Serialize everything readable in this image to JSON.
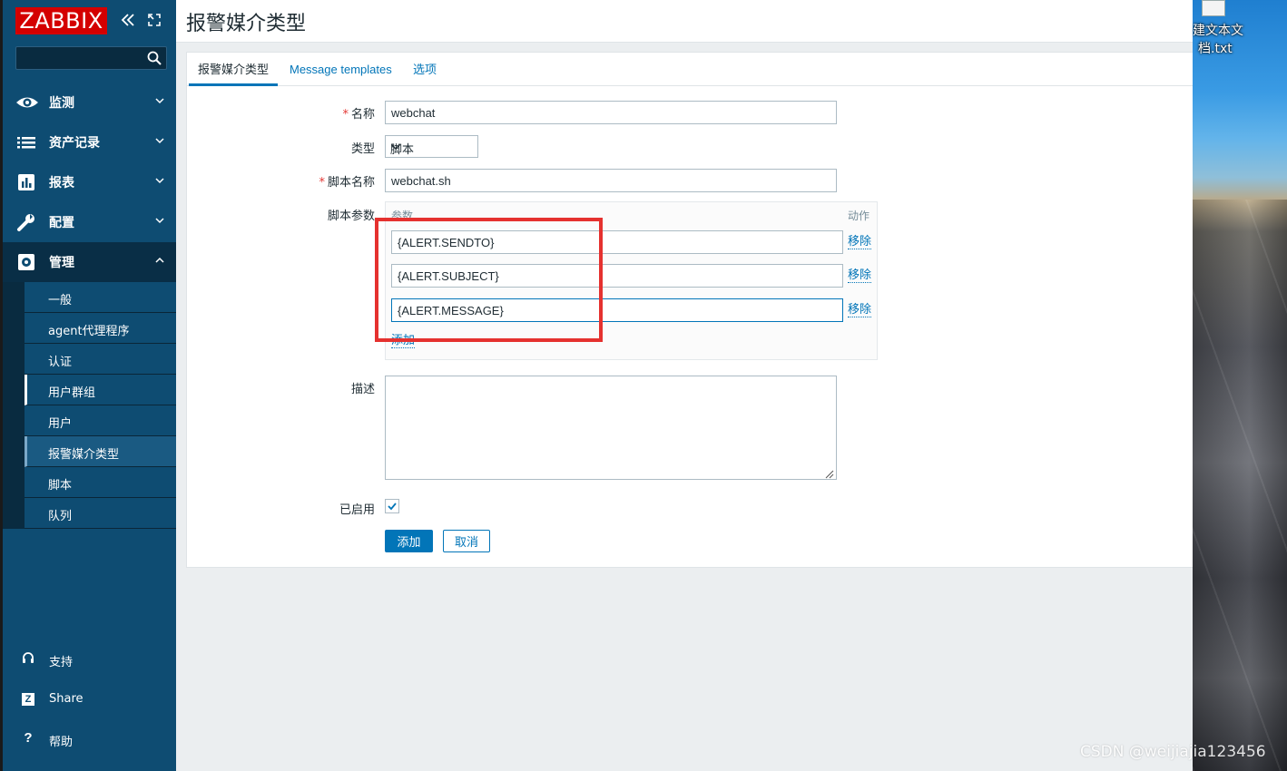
{
  "app": {
    "logo": "ZABBIX"
  },
  "sidebar": {
    "search_placeholder": "",
    "menu": [
      {
        "label": "监测"
      },
      {
        "label": "资产记录"
      },
      {
        "label": "报表"
      },
      {
        "label": "配置"
      },
      {
        "label": "管理"
      }
    ],
    "admin_submenu": [
      {
        "label": "一般"
      },
      {
        "label": "agent代理程序"
      },
      {
        "label": "认证"
      },
      {
        "label": "用户群组"
      },
      {
        "label": "用户"
      },
      {
        "label": "报警媒介类型"
      },
      {
        "label": "脚本"
      },
      {
        "label": "队列"
      }
    ],
    "bottom": [
      {
        "icon": "headset-icon",
        "label": "支持"
      },
      {
        "icon": "zabbix-share-icon",
        "glyph": "Z",
        "label": "Share"
      },
      {
        "icon": "help-icon",
        "glyph": "?",
        "label": "帮助"
      }
    ]
  },
  "header": {
    "title": "报警媒介类型"
  },
  "tabs": [
    {
      "label": "报警媒介类型",
      "active": true
    },
    {
      "label": "Message templates",
      "active": false
    },
    {
      "label": "选项",
      "active": false
    }
  ],
  "form": {
    "name_label": "名称",
    "name_value": "webchat",
    "type_label": "类型",
    "type_value": "脚本",
    "script_name_label": "脚本名称",
    "script_name_value": "webchat.sh",
    "script_params_label": "脚本参数",
    "params_header_param": "参数",
    "params_header_action": "动作",
    "params": [
      {
        "value": "{ALERT.SENDTO}",
        "remove": "移除"
      },
      {
        "value": "{ALERT.SUBJECT}",
        "remove": "移除"
      },
      {
        "value": "{ALERT.MESSAGE}",
        "remove": "移除"
      }
    ],
    "add_param": "添加",
    "description_label": "描述",
    "description_value": "",
    "enabled_label": "已启用",
    "enabled": true,
    "submit_label": "添加",
    "cancel_label": "取消",
    "required_mark": "*"
  },
  "desktop": {
    "file_label_line1": "建文本文",
    "file_label_line2": "档.txt"
  },
  "watermark": "CSDN @weijiajia123456",
  "colors": {
    "sidebar_bg": "#0e4c72",
    "accent": "#0275b8",
    "logo_red": "#d40000",
    "highlight_red": "#e5312f"
  }
}
